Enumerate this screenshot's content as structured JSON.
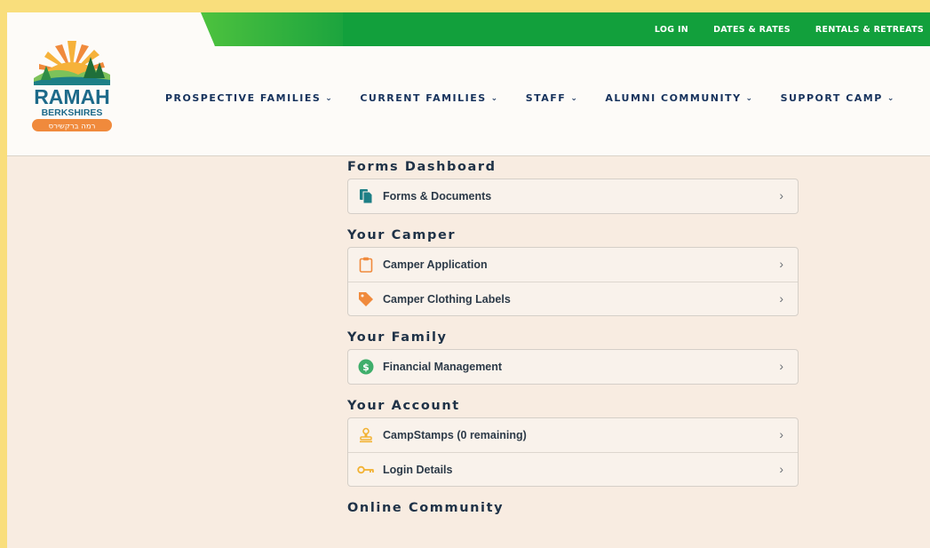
{
  "brand": {
    "name": "RAMAH",
    "sub": "BERKSHIRES",
    "hebrew": "רמה ברקשירס",
    "colors": {
      "green": "#12a03c",
      "navy": "#16325c",
      "orange": "#f08a3c",
      "teal": "#1d7f86"
    }
  },
  "util_nav": [
    "LOG IN",
    "DATES & RATES",
    "RENTALS & RETREATS"
  ],
  "main_nav": [
    {
      "label": "PROSPECTIVE FAMILIES"
    },
    {
      "label": "CURRENT FAMILIES"
    },
    {
      "label": "STAFF"
    },
    {
      "label": "ALUMNI COMMUNITY"
    },
    {
      "label": "SUPPORT CAMP"
    }
  ],
  "sections": {
    "forms": {
      "title": "Forms Dashboard",
      "items": [
        {
          "label": "Forms & Documents",
          "icon": "documents-icon"
        }
      ]
    },
    "camper": {
      "title": "Your Camper",
      "items": [
        {
          "label": "Camper Application",
          "icon": "clipboard-icon"
        },
        {
          "label": "Camper Clothing Labels",
          "icon": "tag-icon"
        }
      ]
    },
    "family": {
      "title": "Your Family",
      "items": [
        {
          "label": "Financial Management",
          "icon": "dollar-icon"
        }
      ]
    },
    "account": {
      "title": "Your Account",
      "items": [
        {
          "label": "CampStamps (0 remaining)",
          "icon": "stamp-icon"
        },
        {
          "label": "Login Details",
          "icon": "key-icon"
        }
      ]
    },
    "community": {
      "title": "Online Community"
    }
  }
}
